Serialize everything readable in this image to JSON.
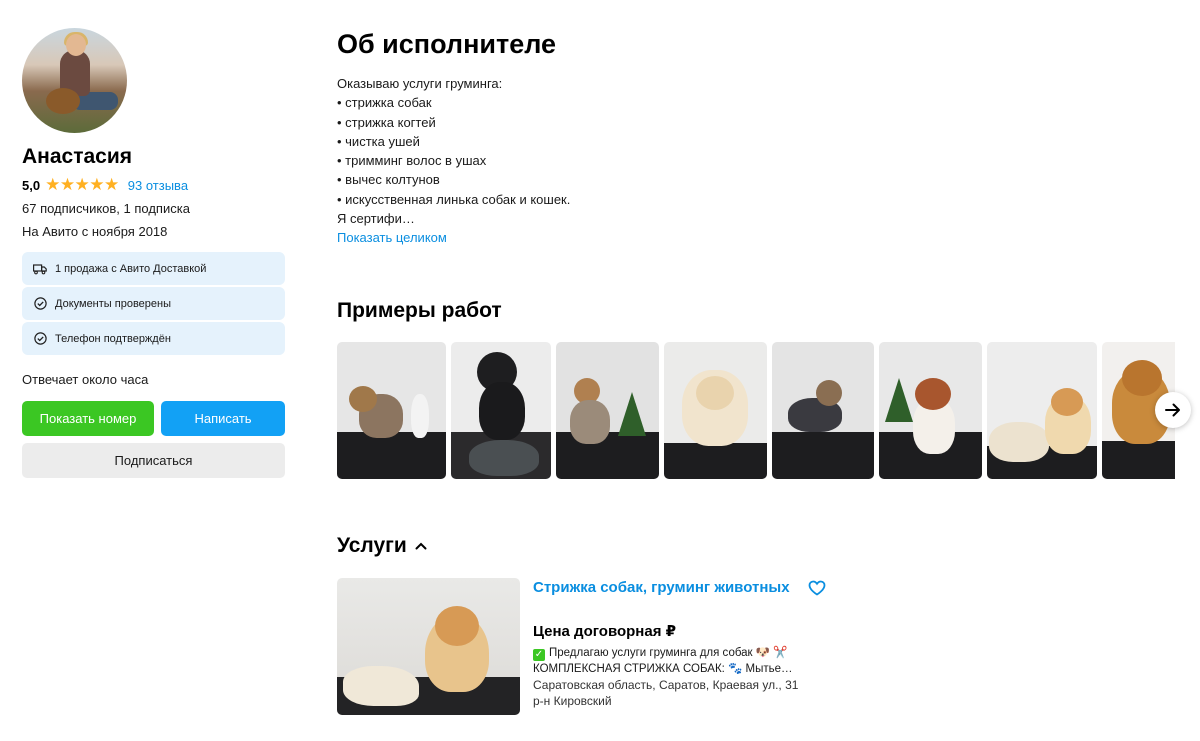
{
  "profile": {
    "name": "Анастасия",
    "rating": "5,0",
    "stars": "★★★★★",
    "reviews_link": "93 отзыва",
    "followers": "67 подписчиков, 1 подписка",
    "since": "На Авито с ноября 2018",
    "badges": [
      {
        "icon": "truck-icon",
        "label": "1 продажа с Авито Доставкой"
      },
      {
        "icon": "check-circle-icon",
        "label": "Документы проверены"
      },
      {
        "icon": "check-circle-icon",
        "label": "Телефон подтверждён"
      }
    ],
    "response_time": "Отвечает около часа",
    "buttons": {
      "show_number": "Показать номер",
      "write": "Написать",
      "subscribe": "Подписаться"
    }
  },
  "about": {
    "title": "Об исполнителе",
    "lines": [
      "Оказываю услуги груминга:",
      "• стрижка собак",
      "• стрижка когтей",
      "• чистка ушей",
      "• тримминг волос в ушах",
      "• вычес колтунов",
      "• искусственная линька собак и кошек.",
      "Я сертифи…"
    ],
    "show_all": "Показать целиком"
  },
  "works": {
    "title": "Примеры работ",
    "next_icon": "arrow-right-icon"
  },
  "services": {
    "title": "Услуги",
    "toggle_icon": "chevron-up-icon",
    "items": [
      {
        "title": "Стрижка собак, груминг животных",
        "price": "Цена договорная ₽",
        "desc_line1": "Предлагаю услуги груминга для собак 🐶 ✂️",
        "desc_line2": "КОМПЛЕКСНАЯ СТРИЖКА СОБАК: 🐾 Мытье…",
        "address": "Саратовская область, Саратов, Краевая ул., 31",
        "district": "р-н Кировский",
        "fav_icon": "heart-icon"
      }
    ]
  },
  "colors": {
    "link": "#0a8ee0",
    "green_button": "#3bc723",
    "blue_button": "#12a1f5",
    "star": "#ffb021",
    "badge_bg": "#e5f2fc"
  }
}
